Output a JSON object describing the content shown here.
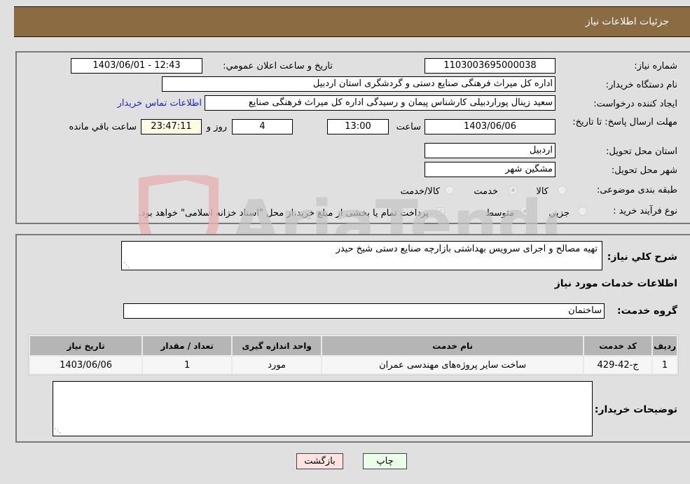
{
  "header": {
    "title": "جزئیات اطلاعات نیاز"
  },
  "form": {
    "need_number": {
      "label": "شماره نیاز:",
      "value": "1103003695000038"
    },
    "announce_datetime": {
      "label": "تاریخ و ساعت اعلان عمومي:",
      "value": "1403/06/01 - 12:43"
    },
    "buyer_org": {
      "label": "نام دستگاه خريدار:",
      "value": "اداره کل میراث فرهنگی  صنایع دستی و گردشگری استان اردبیل"
    },
    "creator": {
      "label": "ايجاد کننده درخواست:",
      "value": "سعید زینال پوراردبیلی کارشناس پیمان و رسیدگی اداره کل میراث فرهنگی  صنایع"
    },
    "buyer_contact_link": "اطلاعات تماس خريدار",
    "deadline": {
      "label": "مهلت ارسال پاسخ: تا تاریخ:",
      "date": "1403/06/06",
      "time_label": "ساعت",
      "time": "13:00",
      "days": "4",
      "days_label": "روز و",
      "remaining": "23:47:11",
      "remaining_label": "ساعت باقي مانده"
    },
    "delivery_province": {
      "label": "استان محل تحويل:",
      "value": "اردبیل"
    },
    "delivery_city": {
      "label": "شهر محل تحويل:",
      "value": "مشگین شهر"
    },
    "category": {
      "label": "طبقه بندی موضوعی:",
      "options": [
        "کالا",
        "خدمت",
        "کالا/خدمت"
      ],
      "selected": "خدمت"
    },
    "purchase_type": {
      "label": "نوع فرآيند خريد :",
      "options": [
        "جزيي",
        "متوسط"
      ],
      "selected": "متوسط",
      "treasury_note": "پرداخت تمام یا بخشی از مبلغ خرید،از محل \"اسناد خزانه اسلامی\" خواهد بود.",
      "treasury_checked": true
    }
  },
  "details": {
    "description_label": "شرح کلي نياز:",
    "description_value": "تهیه مصالح و اجرای سرویس بهداشتی بازارچه صنایع دستی شیخ حیدر",
    "services_heading": "اطلاعات خدمات مورد نياز",
    "service_group_label": "گروه خدمت:",
    "service_group_value": "ساختمان",
    "table": {
      "headers": [
        "رديف",
        "کد خدمت",
        "نام خدمت",
        "واحد اندازه گيری",
        "تعداد / مقدار",
        "تاريخ نياز"
      ],
      "rows": [
        [
          "1",
          "ج-42-429",
          "ساخت سایر پروژه‌های مهندسی عمران",
          "مورد",
          "1",
          "1403/06/06"
        ]
      ]
    },
    "buyer_notes_label": "توضيحات خريدار:",
    "buyer_notes_value": ""
  },
  "buttons": {
    "print": "چاپ",
    "back": "بازگشت"
  },
  "watermark": "AriaTender.neT"
}
